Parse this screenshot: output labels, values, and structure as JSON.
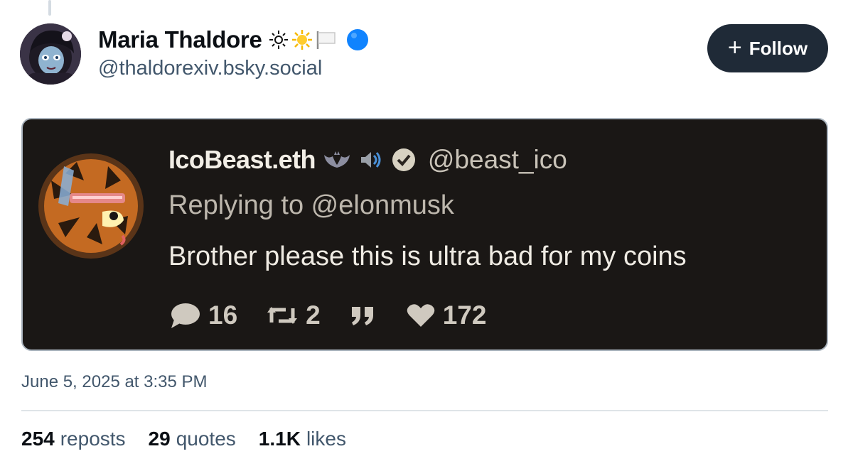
{
  "post": {
    "author": {
      "display_name": "Maria Thaldore",
      "display_name_emojis": [
        "sun-outline",
        "sun",
        "white-flag",
        "blue-circle"
      ],
      "handle": "@thaldorexiv.bsky.social"
    },
    "follow_label": "Follow",
    "timestamp": "June 5, 2025 at 3:35 PM",
    "stats": {
      "reposts_count": "254",
      "reposts_label": "reposts",
      "quotes_count": "29",
      "quotes_label": "quotes",
      "likes_count": "1.1K",
      "likes_label": "likes"
    }
  },
  "quoted": {
    "name": "IcoBeast.eth",
    "name_emojis": [
      "bat",
      "speaker",
      "verified-badge"
    ],
    "handle": "@beast_ico",
    "replying_to": "Replying to @elonmusk",
    "text": "Brother please this is ultra bad for my coins",
    "actions": {
      "replies": "16",
      "retweets": "2",
      "likes": "172"
    }
  },
  "colors": {
    "follow_bg": "#1f2a37",
    "embed_bg": "#1a1715",
    "handle": "#42576c",
    "verified_blue": "#1083fe"
  }
}
